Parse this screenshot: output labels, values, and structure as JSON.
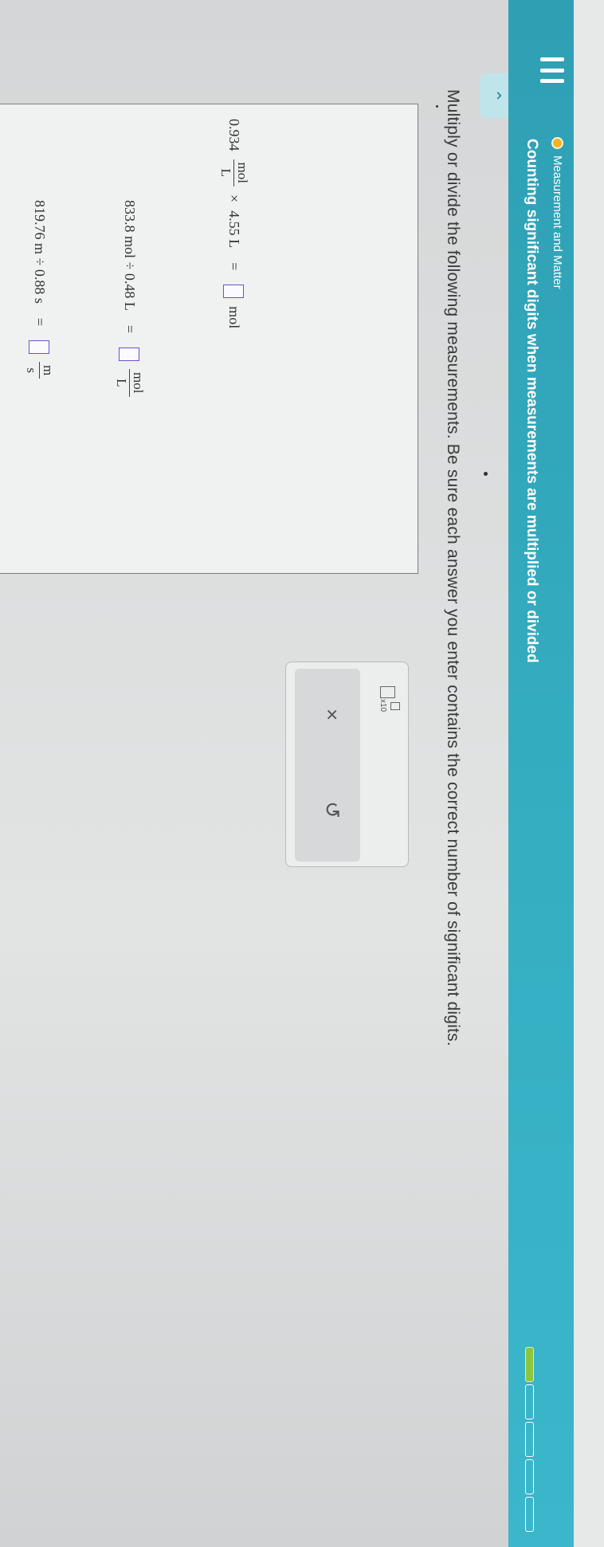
{
  "header": {
    "topic": "Measurement and Matter",
    "title": "Counting significant digits when measurements are multiplied or divided",
    "progress": {
      "filled": 1,
      "total": 5
    }
  },
  "question": {
    "text": "Multiply or divide the following measurements. Be sure each answer you enter contains the correct number of significant digits."
  },
  "equations": [
    {
      "coef": "0.934",
      "unit_num": "mol",
      "unit_den": "L",
      "op": "×",
      "operand": "4.55 L",
      "eq": "=",
      "answer": "",
      "answer_unit": "mol"
    },
    {
      "lhs": "833.8 mol ÷ 0.48 L",
      "eq": "=",
      "answer": "",
      "unit_num": "mol",
      "unit_den": "L"
    },
    {
      "lhs": "819.76 m ÷ 0.88 s",
      "eq": "=",
      "answer": "",
      "unit_num": "m",
      "unit_den": "s"
    }
  ],
  "tools": {
    "sci_label": "x10",
    "clear_symbol": "×",
    "undo_symbol": "↺"
  }
}
